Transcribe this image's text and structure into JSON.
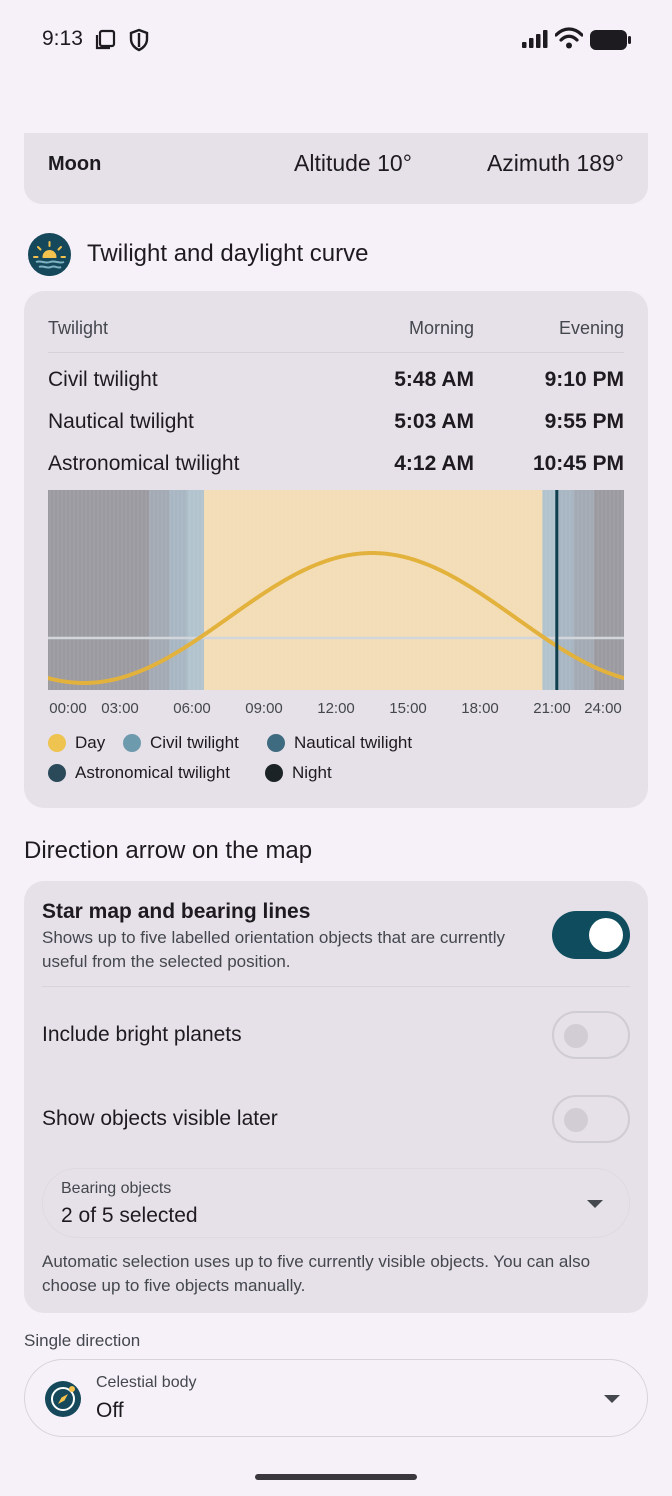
{
  "status_bar": {
    "time": "9:13",
    "left_icons": [
      "screenshot-icon",
      "shield-icon"
    ],
    "right_icons": [
      "signal-icon",
      "wifi-icon",
      "battery-icon"
    ]
  },
  "moon": {
    "label": "Moon",
    "altitude": "Altitude 10°",
    "azimuth": "Azimuth 189°"
  },
  "twilight_section": {
    "title": "Twilight and daylight curve",
    "icon": "sunrise-icon"
  },
  "twilight_table": {
    "headers": {
      "name": "Twilight",
      "morning": "Morning",
      "evening": "Evening"
    },
    "rows": [
      {
        "name": "Civil twilight",
        "morning": "5:48 AM",
        "evening": "9:10 PM"
      },
      {
        "name": "Nautical twilight",
        "morning": "5:03 AM",
        "evening": "9:55 PM"
      },
      {
        "name": "Astronomical twilight",
        "morning": "4:12 AM",
        "evening": "10:45 PM"
      }
    ]
  },
  "chart_data": {
    "type": "area",
    "x_ticks": [
      "00:00",
      "03:00",
      "06:00",
      "09:00",
      "12:00",
      "15:00",
      "18:00",
      "21:00",
      "24:00"
    ],
    "xlim": [
      0,
      24
    ],
    "bands": [
      {
        "name": "Night",
        "from": 0,
        "to": 4.2
      },
      {
        "name": "Astronomical twilight",
        "from": 4.2,
        "to": 5.05
      },
      {
        "name": "Nautical twilight",
        "from": 5.05,
        "to": 5.8
      },
      {
        "name": "Civil twilight",
        "from": 5.8,
        "to": 6.5
      },
      {
        "name": "Day",
        "from": 6.5,
        "to": 20.6
      },
      {
        "name": "Civil twilight",
        "from": 20.6,
        "to": 21.2
      },
      {
        "name": "Nautical twilight",
        "from": 21.2,
        "to": 21.9
      },
      {
        "name": "Astronomical twilight",
        "from": 21.9,
        "to": 22.75
      },
      {
        "name": "Night",
        "from": 22.75,
        "to": 24
      }
    ],
    "current_time": 21.2,
    "sun_curve_peak_hour": 13.5,
    "legend": [
      {
        "name": "Day",
        "color": "#efc34f"
      },
      {
        "name": "Civil twilight",
        "color": "#6e9aae"
      },
      {
        "name": "Nautical twilight",
        "color": "#3f6b80"
      },
      {
        "name": "Astronomical twilight",
        "color": "#2a4a5a"
      },
      {
        "name": "Night",
        "color": "#1b2326"
      }
    ],
    "colors": {
      "night": "#9a9aa0",
      "astro": "#a3aab4",
      "nautical": "#a7b6c2",
      "civil": "#b1c3cd",
      "day": "#f3ddb7",
      "curve": "#e3b23c",
      "now_line": "#0f3e4e",
      "horizon": "#d2d5da"
    }
  },
  "direction_section": {
    "title": "Direction arrow on the map",
    "star_map": {
      "title": "Star map and bearing lines",
      "description": "Shows up to five labelled orientation objects that are currently useful from the selected position.",
      "enabled": true
    },
    "include_planets": {
      "label": "Include bright planets",
      "enabled": false
    },
    "show_later": {
      "label": "Show objects visible later",
      "enabled": false
    },
    "bearing_objects": {
      "label": "Bearing objects",
      "value": "2 of 5 selected"
    },
    "auto_note": "Automatic selection uses up to five currently visible objects. You can also choose up to five objects manually."
  },
  "single_direction": {
    "section_label": "Single direction",
    "field_label": "Celestial body",
    "value": "Off",
    "icon": "compass-icon"
  }
}
